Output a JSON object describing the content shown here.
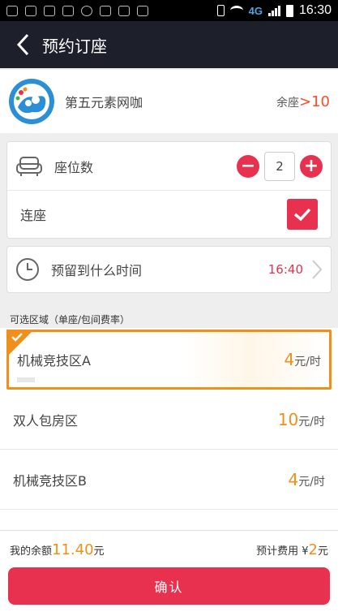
{
  "status_bar": {
    "time": "16:30",
    "network": "4G"
  },
  "header": {
    "title": "预约订座"
  },
  "shop": {
    "name": "第五元素网咖",
    "seats_label": "余座",
    "seats_prefix": ">",
    "seats_value": "10"
  },
  "seat_count": {
    "label": "座位数",
    "value": "2",
    "minus": "−",
    "plus": "+"
  },
  "consecutive": {
    "label": "连座",
    "checked": true
  },
  "reserve_time": {
    "label": "预留到什么时间",
    "value": "16:40"
  },
  "zones": {
    "title": "可选区域（单座/包间费率）",
    "items": [
      {
        "name": "机械竞技区A",
        "price": "4",
        "unit": "元/时",
        "selected": true
      },
      {
        "name": "双人包房区",
        "price": "10",
        "unit": "元/时",
        "selected": false
      },
      {
        "name": "机械竞技区B",
        "price": "4",
        "unit": "元/时",
        "selected": false
      }
    ]
  },
  "footer": {
    "balance_label": "我的余额",
    "balance_value": "11.40",
    "balance_unit": "元",
    "estimate_label": "预计费用",
    "estimate_currency": "¥",
    "estimate_value": "2",
    "estimate_unit": "元",
    "confirm_label": "确认"
  },
  "colors": {
    "accent": "#e8314e",
    "orange": "#f0901a",
    "header_bg": "#1d1f2b"
  }
}
